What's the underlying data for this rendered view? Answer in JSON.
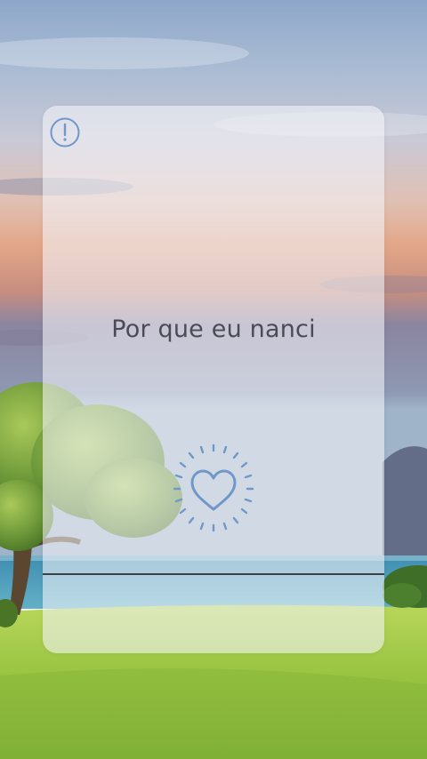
{
  "card": {
    "quote_text": "Por que eu nanci"
  },
  "icons": {
    "info": "exclamation-circle-icon",
    "like": "heart-sparkle-icon"
  },
  "colors": {
    "quote_text": "#4a4b55",
    "accent_blue": "#6f98c8",
    "card_bg": "rgba(245,245,250,0.58)"
  }
}
